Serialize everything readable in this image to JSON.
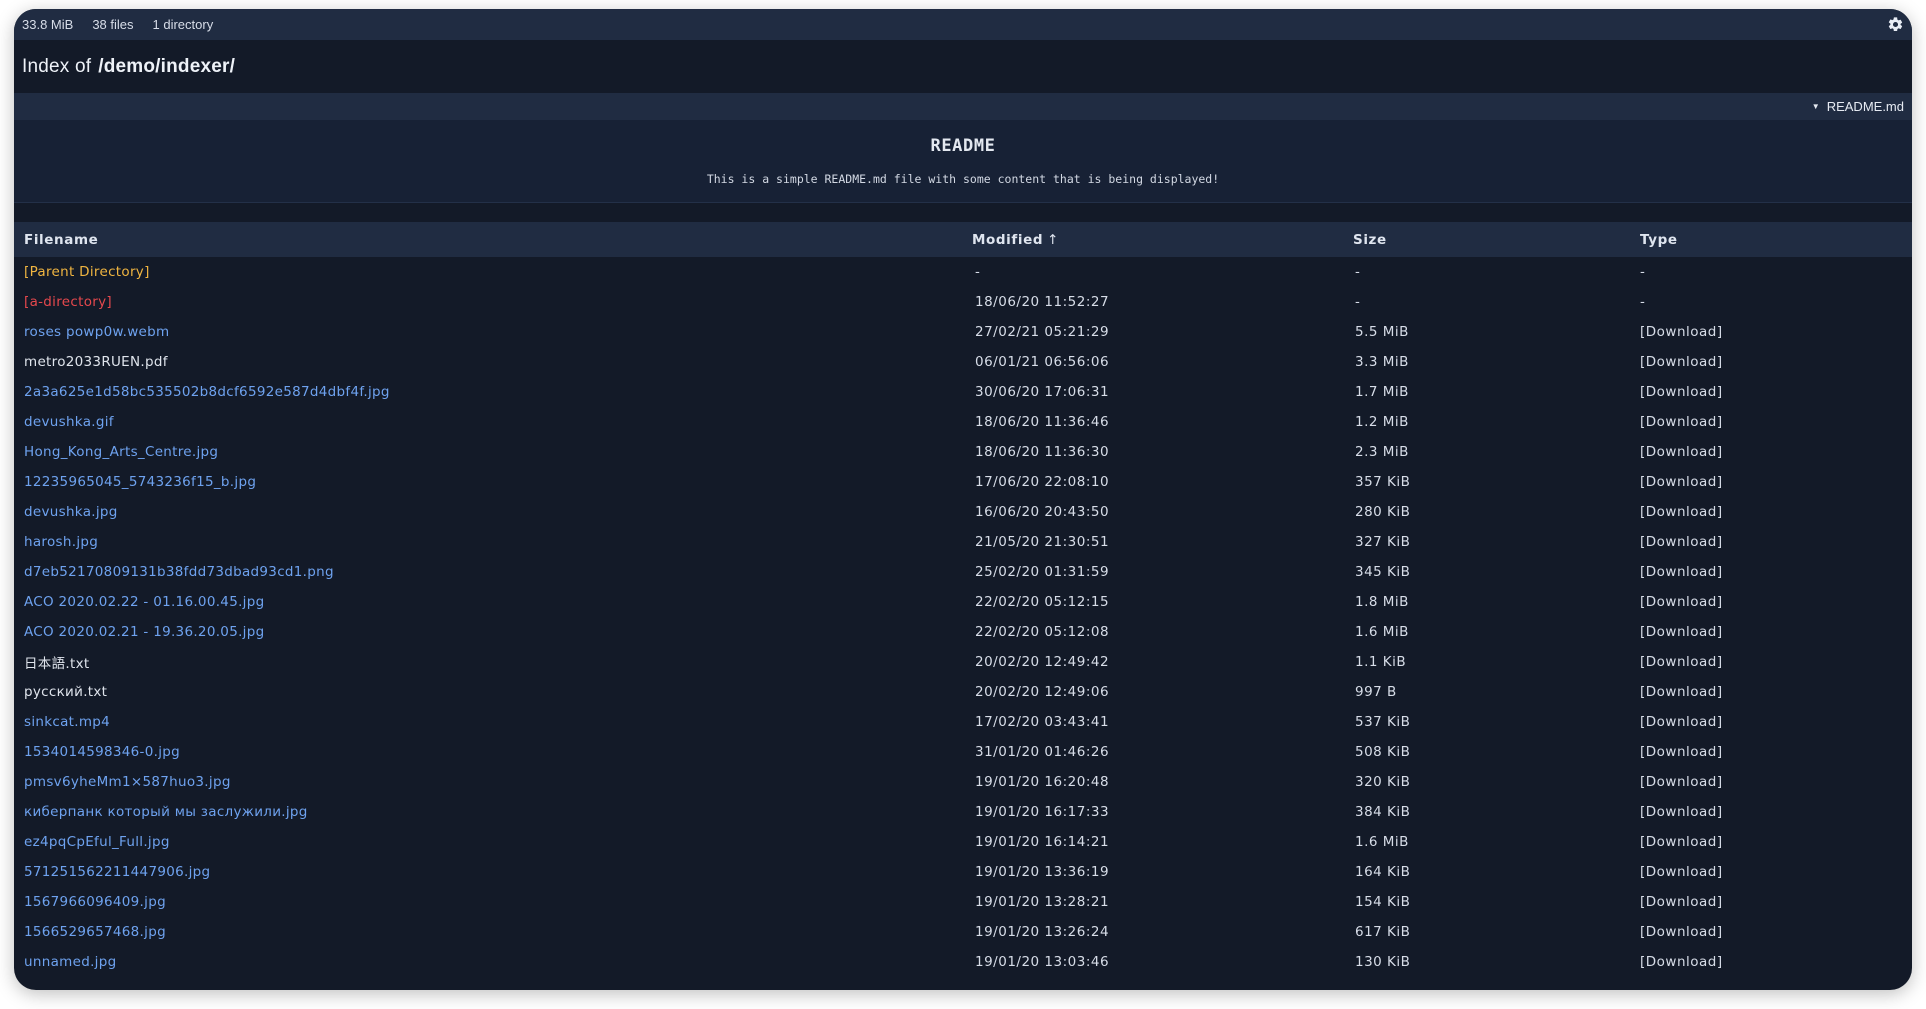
{
  "stats": {
    "size": "33.8 MiB",
    "files": "38 files",
    "dirs": "1 directory"
  },
  "header": {
    "prefix": "Index of",
    "path": "/demo/indexer/"
  },
  "readme_toggle": {
    "arrow": "▼",
    "label": "README.md"
  },
  "readme": {
    "title": "README",
    "body": "This is a simple README.md file with some content that is being displayed!"
  },
  "table": {
    "columns": {
      "name": "Filename",
      "modified": "Modified",
      "modified_sort": "↑",
      "size": "Size",
      "type": "Type"
    },
    "rows": [
      {
        "name": "[Parent Directory]",
        "modified": "-",
        "size": "-",
        "type": "-",
        "kind": "parent"
      },
      {
        "name": "[a-directory]",
        "modified": "18/06/20 11:52:27",
        "size": "-",
        "type": "-",
        "kind": "dir"
      },
      {
        "name": "roses powp0w.webm",
        "modified": "27/02/21 05:21:29",
        "size": "5.5 MiB",
        "type": "[Download]",
        "kind": "link"
      },
      {
        "name": "metro2033RUEN.pdf",
        "modified": "06/01/21 06:56:06",
        "size": "3.3 MiB",
        "type": "[Download]",
        "kind": "plain"
      },
      {
        "name": "2a3a625e1d58bc535502b8dcf6592e587d4dbf4f.jpg",
        "modified": "30/06/20 17:06:31",
        "size": "1.7 MiB",
        "type": "[Download]",
        "kind": "link"
      },
      {
        "name": "devushka.gif",
        "modified": "18/06/20 11:36:46",
        "size": "1.2 MiB",
        "type": "[Download]",
        "kind": "link"
      },
      {
        "name": "Hong_Kong_Arts_Centre.jpg",
        "modified": "18/06/20 11:36:30",
        "size": "2.3 MiB",
        "type": "[Download]",
        "kind": "link"
      },
      {
        "name": "12235965045_5743236f15_b.jpg",
        "modified": "17/06/20 22:08:10",
        "size": "357 KiB",
        "type": "[Download]",
        "kind": "link"
      },
      {
        "name": "devushka.jpg",
        "modified": "16/06/20 20:43:50",
        "size": "280 KiB",
        "type": "[Download]",
        "kind": "link"
      },
      {
        "name": "harosh.jpg",
        "modified": "21/05/20 21:30:51",
        "size": "327 KiB",
        "type": "[Download]",
        "kind": "link"
      },
      {
        "name": "d7eb52170809131b38fdd73dbad93cd1.png",
        "modified": "25/02/20 01:31:59",
        "size": "345 KiB",
        "type": "[Download]",
        "kind": "link"
      },
      {
        "name": "ACO 2020.02.22 - 01.16.00.45.jpg",
        "modified": "22/02/20 05:12:15",
        "size": "1.8 MiB",
        "type": "[Download]",
        "kind": "link"
      },
      {
        "name": "ACO 2020.02.21 - 19.36.20.05.jpg",
        "modified": "22/02/20 05:12:08",
        "size": "1.6 MiB",
        "type": "[Download]",
        "kind": "link"
      },
      {
        "name": "日本語.txt",
        "modified": "20/02/20 12:49:42",
        "size": "1.1 KiB",
        "type": "[Download]",
        "kind": "plain"
      },
      {
        "name": "русский.txt",
        "modified": "20/02/20 12:49:06",
        "size": "997 B",
        "type": "[Download]",
        "kind": "plain"
      },
      {
        "name": "sinkcat.mp4",
        "modified": "17/02/20 03:43:41",
        "size": "537 KiB",
        "type": "[Download]",
        "kind": "link"
      },
      {
        "name": "1534014598346-0.jpg",
        "modified": "31/01/20 01:46:26",
        "size": "508 KiB",
        "type": "[Download]",
        "kind": "link"
      },
      {
        "name": "pmsv6yheMm1×587huo3.jpg",
        "modified": "19/01/20 16:20:48",
        "size": "320 KiB",
        "type": "[Download]",
        "kind": "link"
      },
      {
        "name": "киберпанк который мы заслужили.jpg",
        "modified": "19/01/20 16:17:33",
        "size": "384 KiB",
        "type": "[Download]",
        "kind": "link"
      },
      {
        "name": "ez4pqCpEful_Full.jpg",
        "modified": "19/01/20 16:14:21",
        "size": "1.6 MiB",
        "type": "[Download]",
        "kind": "link"
      },
      {
        "name": "571251562211447906.jpg",
        "modified": "19/01/20 13:36:19",
        "size": "164 KiB",
        "type": "[Download]",
        "kind": "link"
      },
      {
        "name": "1567966096409.jpg",
        "modified": "19/01/20 13:28:21",
        "size": "154 KiB",
        "type": "[Download]",
        "kind": "link"
      },
      {
        "name": "1566529657468.jpg",
        "modified": "19/01/20 13:26:24",
        "size": "617 KiB",
        "type": "[Download]",
        "kind": "link"
      },
      {
        "name": "unnamed.jpg",
        "modified": "19/01/20 13:03:46",
        "size": "130 KiB",
        "type": "[Download]",
        "kind": "link"
      }
    ]
  },
  "colors": {
    "background": "#131a28",
    "bar": "#202c42",
    "parent_link": "#f0b541",
    "directory_link": "#e5484d",
    "file_link": "#6ea2ef",
    "text": "#d7dde8"
  },
  "icons": {
    "settings": "gear-icon"
  }
}
